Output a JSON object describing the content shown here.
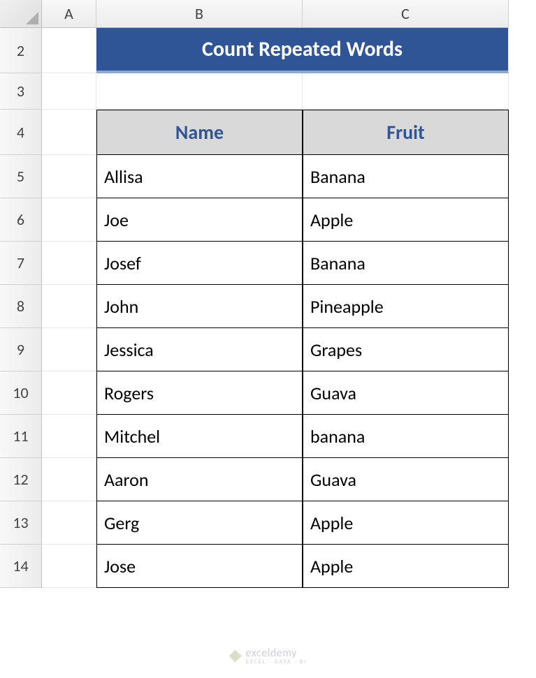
{
  "columns": [
    "A",
    "B",
    "C"
  ],
  "rows": [
    "2",
    "3",
    "4",
    "5",
    "6",
    "7",
    "8",
    "9",
    "10",
    "11",
    "12",
    "13",
    "14"
  ],
  "title": "Count Repeated Words",
  "headers": {
    "name": "Name",
    "fruit": "Fruit"
  },
  "data": [
    {
      "name": "Allisa",
      "fruit": "Banana"
    },
    {
      "name": "Joe",
      "fruit": "Apple"
    },
    {
      "name": "Josef",
      "fruit": "Banana"
    },
    {
      "name": "John",
      "fruit": "Pineapple"
    },
    {
      "name": "Jessica",
      "fruit": "Grapes"
    },
    {
      "name": "Rogers",
      "fruit": "Guava"
    },
    {
      "name": "Mitchel",
      "fruit": "banana"
    },
    {
      "name": "Aaron",
      "fruit": "Guava"
    },
    {
      "name": "Gerg",
      "fruit": "Apple"
    },
    {
      "name": "Jose",
      "fruit": "Apple"
    }
  ],
  "watermark": {
    "brand": "exceldemy",
    "tagline": "EXCEL · DATA · BI"
  },
  "chart_data": {
    "type": "table",
    "title": "Count Repeated Words",
    "columns": [
      "Name",
      "Fruit"
    ],
    "rows": [
      [
        "Allisa",
        "Banana"
      ],
      [
        "Joe",
        "Apple"
      ],
      [
        "Josef",
        "Banana"
      ],
      [
        "John",
        "Pineapple"
      ],
      [
        "Jessica",
        "Grapes"
      ],
      [
        "Rogers",
        "Guava"
      ],
      [
        "Mitchel",
        "banana"
      ],
      [
        "Aaron",
        "Guava"
      ],
      [
        "Gerg",
        "Apple"
      ],
      [
        "Jose",
        "Apple"
      ]
    ]
  }
}
